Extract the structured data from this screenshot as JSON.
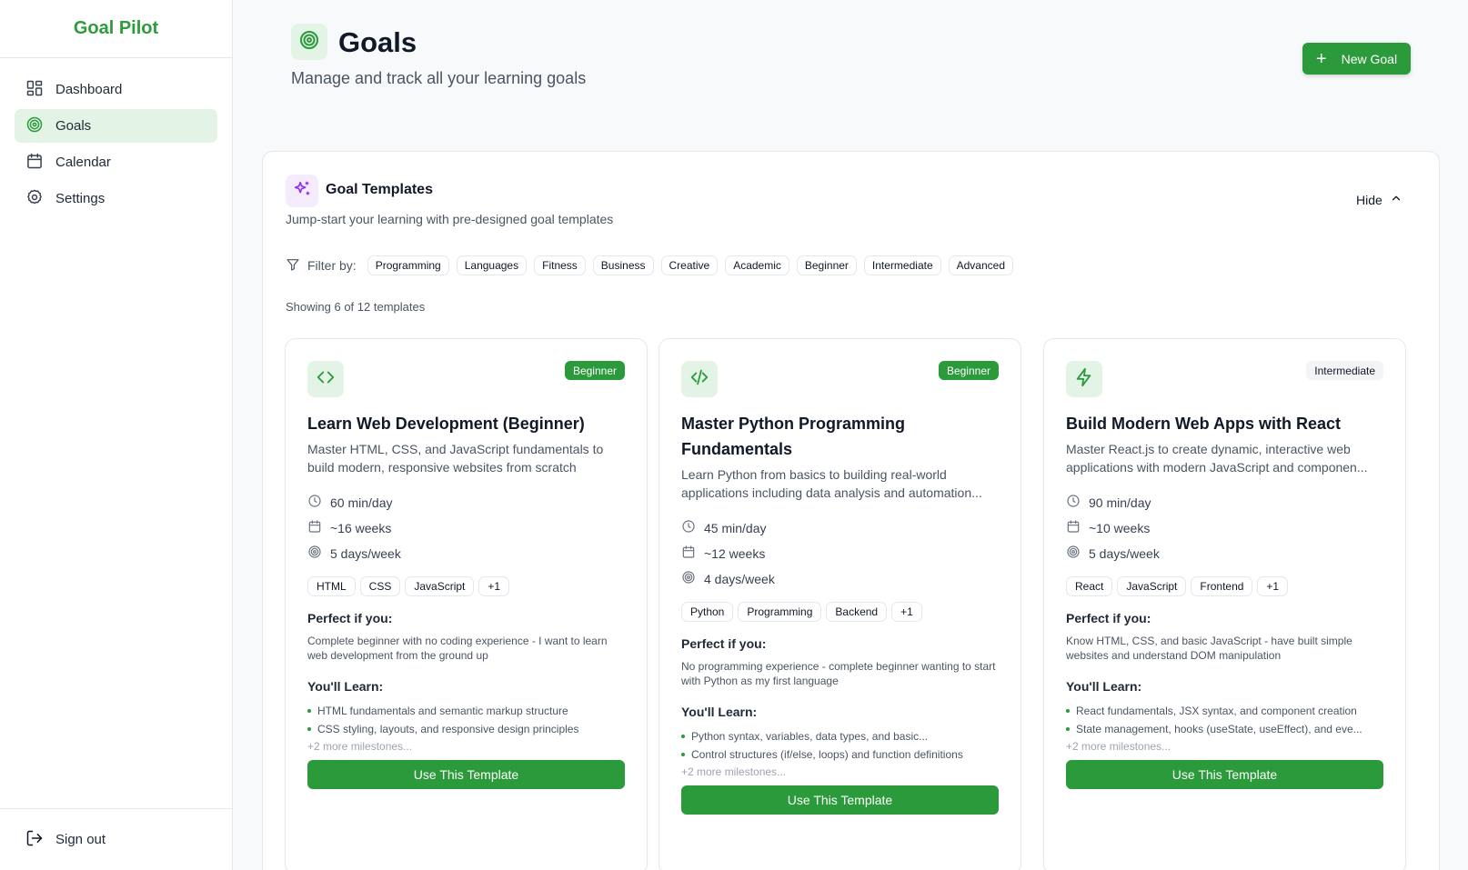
{
  "app": {
    "brand": "Goal Pilot"
  },
  "colors": {
    "accent": "#2a9a3a",
    "accent_light": "#e3f3e5",
    "purple": "#9333ea"
  },
  "sidebar": {
    "items": [
      {
        "label": "Dashboard",
        "icon": "dashboard-icon"
      },
      {
        "label": "Goals",
        "icon": "target-icon",
        "active": true
      },
      {
        "label": "Calendar",
        "icon": "calendar-icon"
      },
      {
        "label": "Settings",
        "icon": "gear-icon"
      }
    ],
    "signout": "Sign out"
  },
  "header": {
    "title": "Goals",
    "subtitle": "Manage and track all your learning goals",
    "new_goal_label": "New Goal"
  },
  "templates": {
    "title": "Goal Templates",
    "subtitle": "Jump-start your learning with pre-designed goal templates",
    "hide_label": "Hide",
    "filter_label": "Filter by:",
    "filters": [
      "Programming",
      "Languages",
      "Fitness",
      "Business",
      "Creative",
      "Academic",
      "Beginner",
      "Intermediate",
      "Advanced"
    ],
    "showing": "Showing 6 of 12 templates",
    "perfect_heading": "Perfect if you:",
    "learn_heading": "You'll Learn:",
    "use_label": "Use This Template",
    "cards": [
      {
        "icon": "code-icon",
        "level": "Beginner",
        "title": "Learn Web Development (Beginner)",
        "description": "Master HTML, CSS, and JavaScript fundamentals to build modern, responsive websites from scratch",
        "minutes": "60 min/day",
        "weeks": "~16 weeks",
        "days": "5 days/week",
        "tags": [
          "HTML",
          "CSS",
          "JavaScript",
          "+1"
        ],
        "perfect": "Complete beginner with no coding experience - I want to learn web development from the ground up",
        "learn": [
          "HTML fundamentals and semantic markup structure",
          "CSS styling, layouts, and responsive design principles"
        ],
        "more": "+2 more milestones..."
      },
      {
        "icon": "code-slash-icon",
        "level": "Beginner",
        "title": "Master Python Programming Fundamentals",
        "description": "Learn Python from basics to building real-world applications including data analysis and automation...",
        "minutes": "45 min/day",
        "weeks": "~12 weeks",
        "days": "4 days/week",
        "tags": [
          "Python",
          "Programming",
          "Backend",
          "+1"
        ],
        "perfect": "No programming experience - complete beginner wanting to start with Python as my first language",
        "learn": [
          "Python syntax, variables, data types, and basic...",
          "Control structures (if/else, loops) and function definitions"
        ],
        "more": "+2 more milestones..."
      },
      {
        "icon": "lightning-icon",
        "level": "Intermediate",
        "title": "Build Modern Web Apps with React",
        "description": "Master React.js to create dynamic, interactive web applications with modern JavaScript and componen...",
        "minutes": "90 min/day",
        "weeks": "~10 weeks",
        "days": "5 days/week",
        "tags": [
          "React",
          "JavaScript",
          "Frontend",
          "+1"
        ],
        "perfect": "Know HTML, CSS, and basic JavaScript - have built simple websites and understand DOM manipulation",
        "learn": [
          "React fundamentals, JSX syntax, and component creation",
          "State management, hooks (useState, useEffect), and eve..."
        ],
        "more": "+2 more milestones..."
      }
    ]
  }
}
